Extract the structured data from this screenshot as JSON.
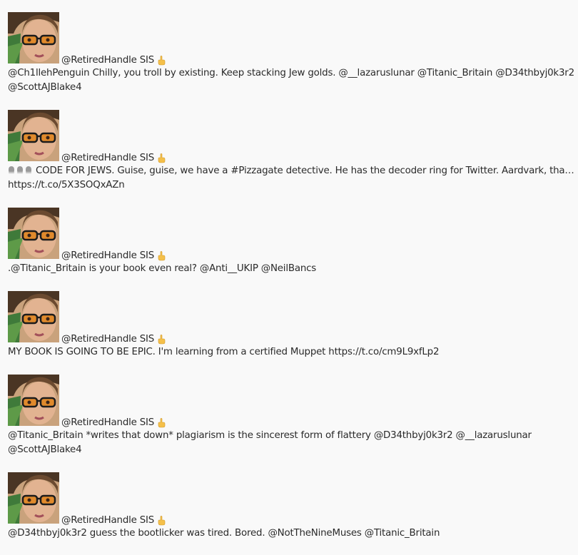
{
  "colors": {
    "background": "#f9f9f9",
    "text": "#2a2a2a",
    "emoji_yellow": "#f5c04a"
  },
  "tweets": [
    {
      "author": "@RetiredHandle SIS",
      "author_icon": "pointing-hand-icon",
      "lines": [
        "@Ch1llehPenguin Chilly, you troll by existing. Keep stacking Jew golds. @__lazaruslunar @Titanic_Britain @D34thbyj0k3r2",
        "@ScottAJBlake4"
      ]
    },
    {
      "author": "@RetiredHandle SIS",
      "author_icon": "pointing-hand-icon",
      "lead_icons": [
        "squid-icon",
        "squid-icon",
        "squid-icon"
      ],
      "lines": [
        "CODE FOR JEWS. Guise, guise, we have a #Pizzagate detective. He has the decoder ring for Twitter. Aardvark, tha…",
        "https://t.co/5X3SOQxAZn"
      ]
    },
    {
      "author": "@RetiredHandle SIS",
      "author_icon": "pointing-hand-icon",
      "lines": [
        ".@Titanic_Britain is your book even real? @Anti__UKIP @NeilBancs"
      ]
    },
    {
      "author": "@RetiredHandle SIS",
      "author_icon": "pointing-hand-icon",
      "lines": [
        "MY BOOK IS GOING TO BE EPIC. I'm learning from a certified Muppet https://t.co/cm9L9xfLp2"
      ]
    },
    {
      "author": "@RetiredHandle SIS",
      "author_icon": "pointing-hand-icon",
      "lines": [
        "@Titanic_Britain *writes that down* plagiarism is the sincerest form of flattery @D34thbyj0k3r2 @__lazaruslunar",
        "@ScottAJBlake4"
      ]
    },
    {
      "author": "@RetiredHandle SIS",
      "author_icon": "pointing-hand-icon",
      "lines": [
        "@D34thbyj0k3r2 guess the bootlicker was tired. Bored. @NotTheNineMuses @Titanic_Britain"
      ]
    }
  ]
}
